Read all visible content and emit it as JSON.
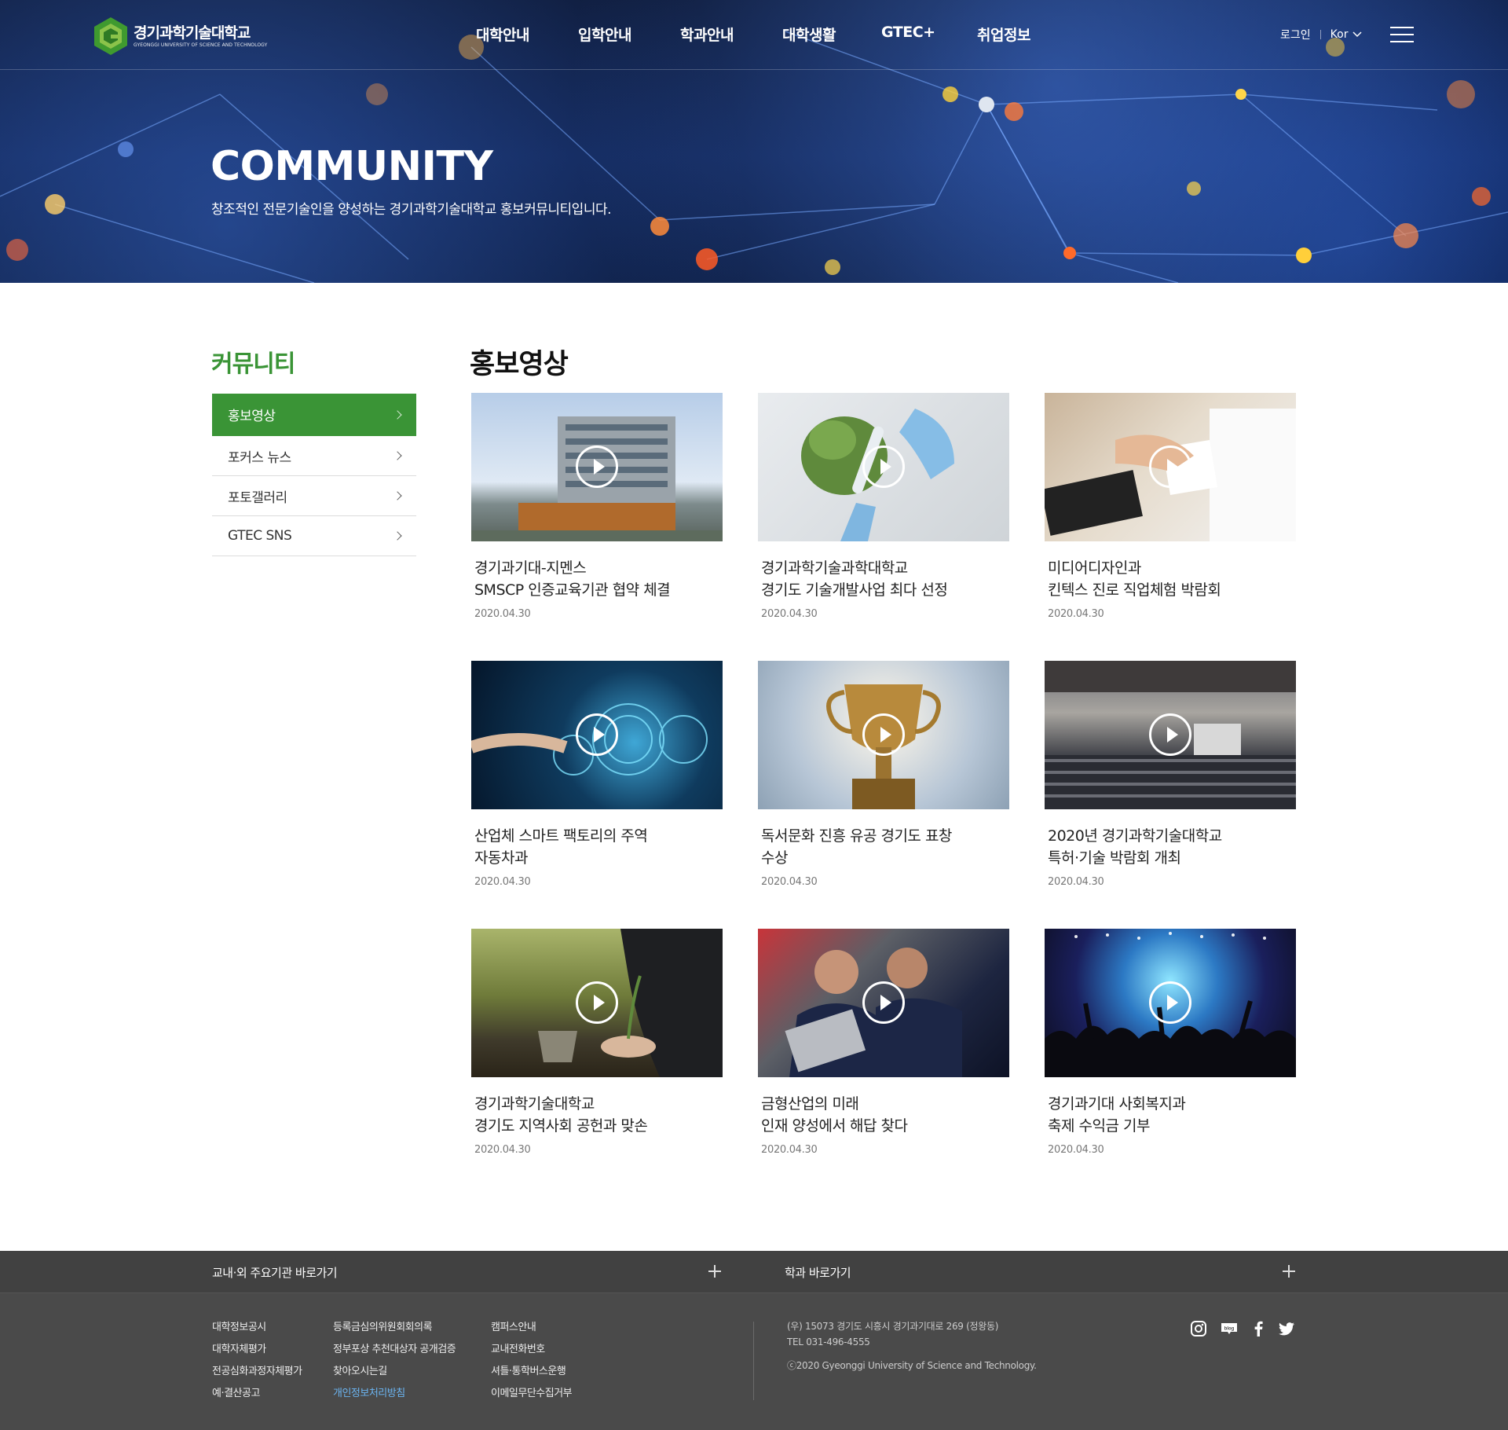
{
  "header": {
    "logo_ko": "경기과학기술대학교",
    "logo_en": "GYEONGGI UNIVERSITY OF SCIENCE AND TECHNOLOGY",
    "nav": [
      "대학안내",
      "입학안내",
      "학과안내",
      "대학생활",
      "GTEC+",
      "취업정보"
    ],
    "login": "로그인",
    "lang": "Kor"
  },
  "hero": {
    "title": "COMMUNITY",
    "desc": "창조적인 전문기술인을 양성하는 경기과학기술대학교 홍보커뮤니티입니다."
  },
  "sidebar": {
    "title": "커뮤니티",
    "items": [
      "홍보영상",
      "포커스 뉴스",
      "포토갤러리",
      "GTEC SNS"
    ],
    "active_index": 0
  },
  "main": {
    "title": "홍보영상",
    "cards": [
      {
        "title": "경기과기대-지멘스\nSMSCP 인증교육기관 협약 체결",
        "date": "2020.04.30"
      },
      {
        "title": "경기과학기술과학대학교\n경기도 기술개발사업 최다 선정",
        "date": "2020.04.30"
      },
      {
        "title": "미디어디자인과\n킨텍스 진로 직업체험 박람회",
        "date": "2020.04.30"
      },
      {
        "title": "산업체 스마트 팩토리의 주역\n자동차과",
        "date": "2020.04.30"
      },
      {
        "title": "독서문화 진흥 유공 경기도 표창\n수상",
        "date": "2020.04.30"
      },
      {
        "title": "2020년 경기과학기술대학교\n특허·기술 박람회 개최",
        "date": "2020.04.30"
      },
      {
        "title": "경기과학기술대학교\n경기도 지역사회 공헌과 맞손",
        "date": "2020.04.30"
      },
      {
        "title": "금형산업의 미래\n인재 양성에서 해답 찾다",
        "date": "2020.04.30"
      },
      {
        "title": "경기과기대 사회복지과\n축제 수익금 기부",
        "date": "2020.04.30"
      }
    ]
  },
  "footer": {
    "quick1": "교내·외 주요기관 바로가기",
    "quick2": "학과 바로가기",
    "col1": [
      "대학정보공시",
      "대학자체평가",
      "전공심화과정자체평가",
      "예·결산공고"
    ],
    "col2": [
      "등록금심의위원회회의록",
      "정부포상 추천대상자 공개검증",
      "찾아오시는길",
      "개인정보처리방침"
    ],
    "col3": [
      "캠퍼스안내",
      "교내전화번호",
      "셔틀·통학버스운행",
      "이메일무단수집거부"
    ],
    "address": "(우) 15073 경기도 시흥시 경기과기대로 269 (정왕동)",
    "tel": "TEL 031-496-4555",
    "copyright": "ⓒ2020 Gyeonggi University of Science and Technology.",
    "sns": [
      "instagram-icon",
      "blog-icon",
      "facebook-icon",
      "twitter-icon"
    ],
    "highlight_color": "#6bb4f0"
  },
  "colors": {
    "brand_green": "#3a9436",
    "footer_bg": "#4a4a4a"
  }
}
